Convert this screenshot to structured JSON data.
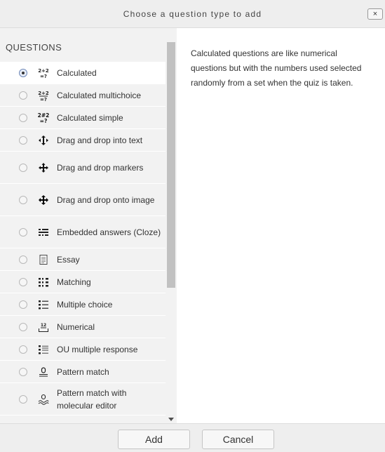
{
  "dialog": {
    "title": "Choose a question type to add",
    "close_glyph": "×"
  },
  "list": {
    "header": "QUESTIONS",
    "items": [
      {
        "label": "Calculated",
        "icon": "calculated-icon",
        "selected": true
      },
      {
        "label": "Calculated multichoice",
        "icon": "calculated-multichoice-icon",
        "selected": false
      },
      {
        "label": "Calculated simple",
        "icon": "calculated-simple-icon",
        "selected": false
      },
      {
        "label": "Drag and drop into text",
        "icon": "drag-drop-text-icon",
        "selected": false
      },
      {
        "label": "Drag and drop markers",
        "icon": "drag-drop-markers-icon",
        "selected": false
      },
      {
        "label": "Drag and drop onto image",
        "icon": "drag-drop-image-icon",
        "selected": false
      },
      {
        "label": "Embedded answers (Cloze)",
        "icon": "cloze-icon",
        "selected": false
      },
      {
        "label": "Essay",
        "icon": "essay-icon",
        "selected": false
      },
      {
        "label": "Matching",
        "icon": "matching-icon",
        "selected": false
      },
      {
        "label": "Multiple choice",
        "icon": "multiple-choice-icon",
        "selected": false
      },
      {
        "label": "Numerical",
        "icon": "numerical-icon",
        "selected": false
      },
      {
        "label": "OU multiple response",
        "icon": "ou-multiple-response-icon",
        "selected": false
      },
      {
        "label": "Pattern match",
        "icon": "pattern-match-icon",
        "selected": false
      },
      {
        "label": "Pattern match with molecular editor",
        "icon": "pattern-match-molecular-icon",
        "selected": false
      }
    ]
  },
  "description": "Calculated questions are like numerical questions but with the numbers used selected randomly from a set when the quiz is taken.",
  "footer": {
    "add_label": "Add",
    "cancel_label": "Cancel"
  }
}
